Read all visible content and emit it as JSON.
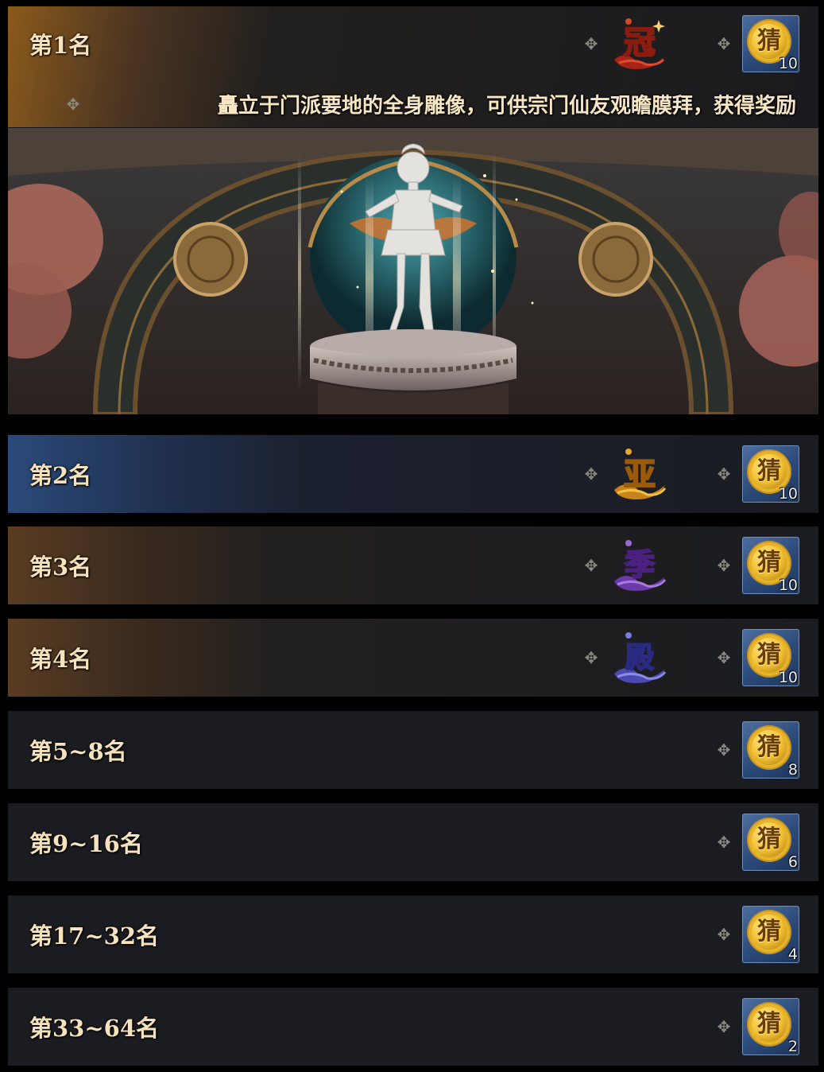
{
  "rewards": [
    {
      "rank": "第1名",
      "badge": "冠",
      "reward_icon": "猜",
      "qty": "10",
      "description": "矗立于门派要地的全身雕像，可供宗门仙友观瞻膜拜，获得奖励"
    },
    {
      "rank": "第2名",
      "badge": "亚",
      "reward_icon": "猜",
      "qty": "10"
    },
    {
      "rank": "第3名",
      "badge": "季",
      "reward_icon": "猜",
      "qty": "10"
    },
    {
      "rank": "第4名",
      "badge": "殿",
      "reward_icon": "猜",
      "qty": "10"
    },
    {
      "rank": "第5~8名",
      "reward_icon": "猜",
      "qty": "8"
    },
    {
      "rank": "第9~16名",
      "reward_icon": "猜",
      "qty": "6"
    },
    {
      "rank": "第17~32名",
      "reward_icon": "猜",
      "qty": "4"
    },
    {
      "rank": "第33~64名",
      "reward_icon": "猜",
      "qty": "2"
    }
  ],
  "colors": {
    "badge_champion": "#c8321e",
    "badge_second": "#e3a52a",
    "badge_third": "#8a5ad0",
    "badge_fourth": "#6a6ee0"
  },
  "scene": {
    "type": "statue-on-pedestal-in-temple-archway"
  }
}
